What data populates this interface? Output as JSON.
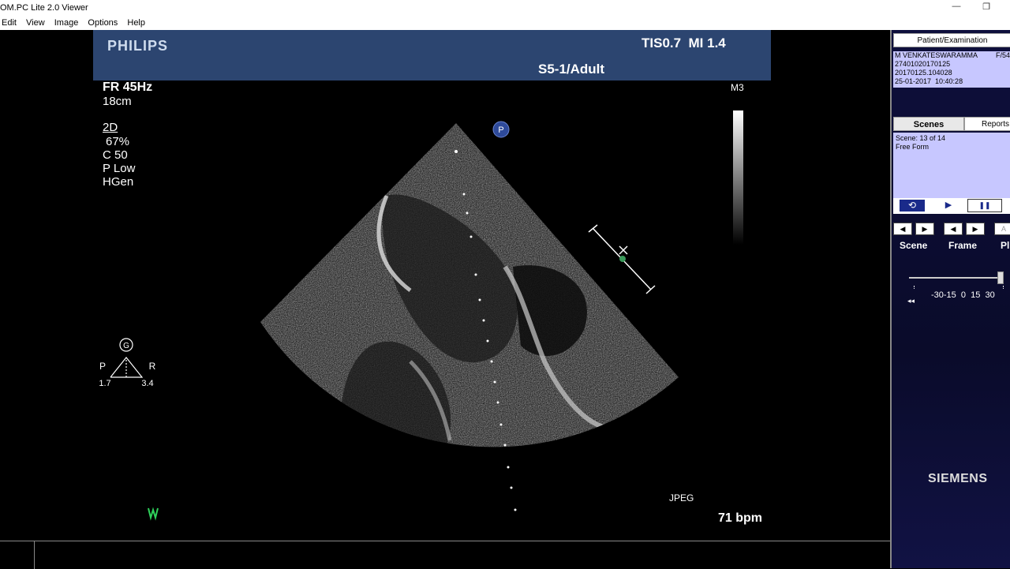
{
  "window": {
    "title": "OM.PC Lite 2.0 Viewer",
    "minimize": "—",
    "restore": "❐"
  },
  "menu": [
    "Edit",
    "View",
    "Image",
    "Options",
    "Help"
  ],
  "image": {
    "brand": "PHILIPS",
    "tis_mi": "TIS0.7  MI 1.4",
    "probe": "S5-1/Adult",
    "fr": "FR 45Hz",
    "depth": "18cm",
    "mode": "2D",
    "gain": "67%",
    "compress": "C 50",
    "power": "P Low",
    "freq": "HGen",
    "scale_label": "M3",
    "p_marker": "P",
    "g_marker": "G",
    "p_label": "P",
    "r_label": "R",
    "left_val": "1.7",
    "right_val": "3.4",
    "jpeg": "JPEG",
    "bpm": "71 bpm"
  },
  "sidebar": {
    "patient_header": "Patient/Examination",
    "patient": {
      "name": "M VENKATESWARAMMA",
      "sex_age": "F/54",
      "id": "27401020170125",
      "study": "20170125.104028",
      "datetime": "25-01-2017  10:40:28"
    },
    "tabs": [
      "Scenes",
      "Reports"
    ],
    "scene_info": [
      "Scene: 13 of 14",
      "Free Form"
    ],
    "playback": {
      "loop": "⟲",
      "play": "▶",
      "pause": "❚❚"
    },
    "nav": {
      "prev": "◀",
      "next": "▶",
      "a_btn": "A"
    },
    "labels": {
      "scene": "Scene",
      "frame": "Frame",
      "play": "Pl"
    },
    "slider_ticks": "-30-15  0  15  30",
    "slider_value": 30,
    "rewind": "◂◂",
    "vendor": "SIEMENS"
  },
  "colors": {
    "banner": "#2c4570",
    "lavender": "#c7c7ff",
    "sidebar": "#0e0f3c"
  }
}
